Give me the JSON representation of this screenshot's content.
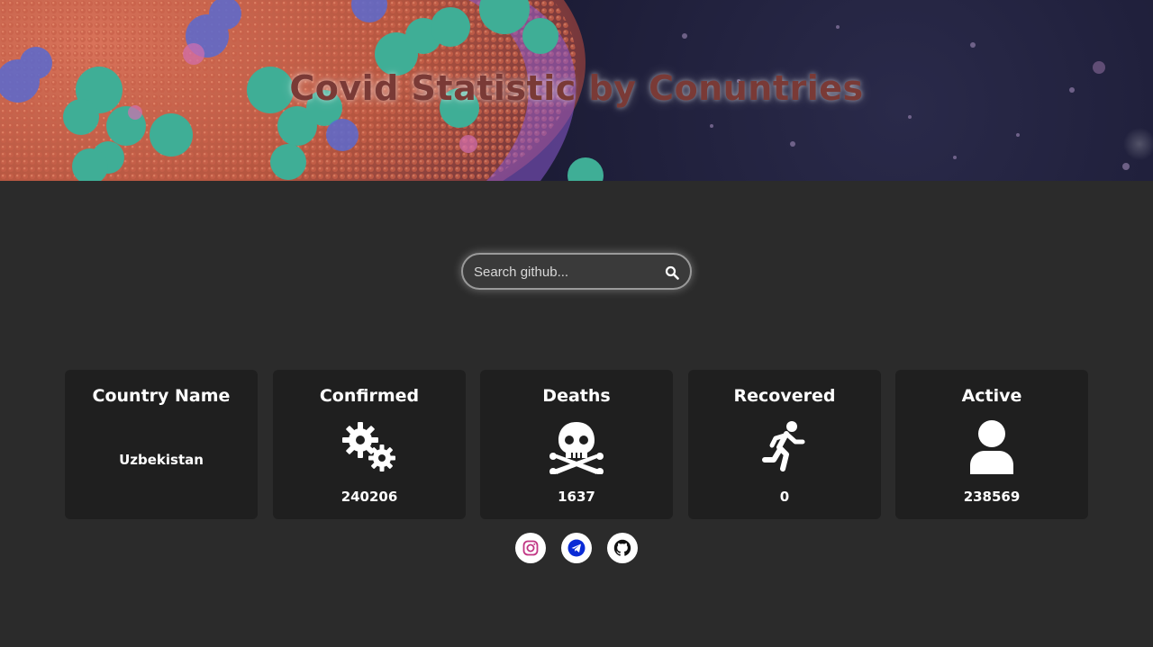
{
  "header": {
    "title": "Covid Statistic by Conuntries"
  },
  "search": {
    "placeholder": "Search github...",
    "value": ""
  },
  "cards": [
    {
      "title": "Country Name",
      "value": "Uzbekistan",
      "icon": "none"
    },
    {
      "title": "Confirmed",
      "value": "240206",
      "icon": "gears-icon"
    },
    {
      "title": "Deaths",
      "value": "1637",
      "icon": "skull-crossbones-icon"
    },
    {
      "title": "Recovered",
      "value": "0",
      "icon": "running-person-icon"
    },
    {
      "title": "Active",
      "value": "238569",
      "icon": "user-icon"
    }
  ],
  "social": [
    {
      "name": "instagram-icon",
      "color": "#c13584"
    },
    {
      "name": "telegram-icon",
      "color": "#0a2bd6"
    },
    {
      "name": "github-icon",
      "color": "#111111"
    }
  ],
  "colors": {
    "background": "#2b2b2b",
    "card": "#1f1f1f",
    "title": "#7a3a36"
  }
}
